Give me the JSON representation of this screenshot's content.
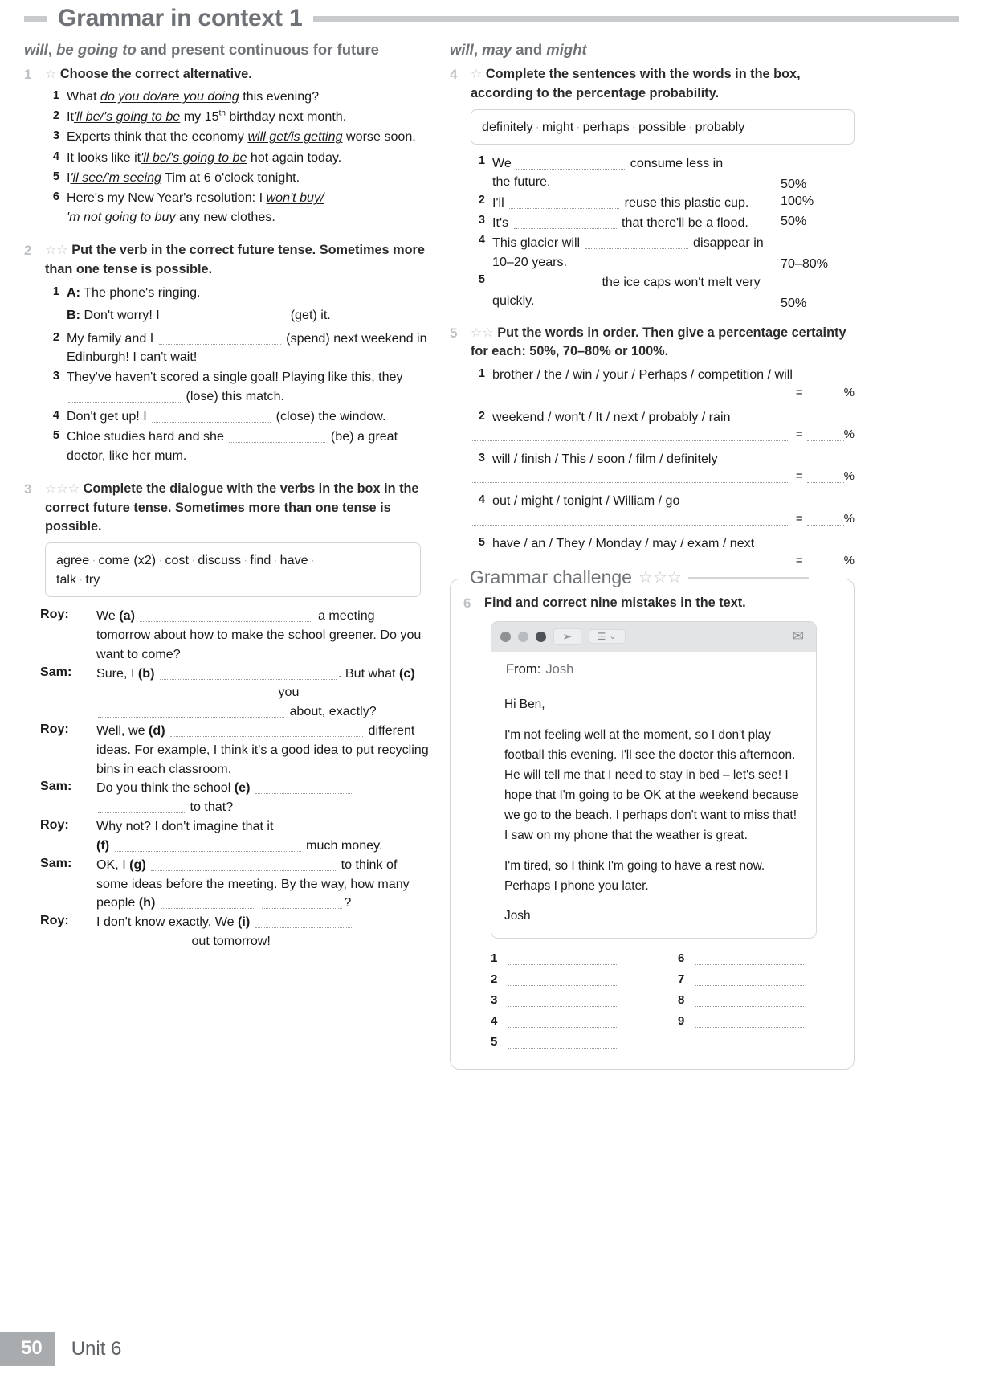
{
  "header": {
    "title": "Grammar in context 1"
  },
  "left": {
    "section_title_html": "will, be going to and present continuous for future",
    "ex1": {
      "num": "1",
      "stars": "☆",
      "rubric": "Choose the correct alternative.",
      "items": [
        "1|What |do you do/are you doing| this evening?",
        "2|It|'ll be/'s going to be| my 15th birthday next month.",
        "3|Experts think that the economy |will get/is getting| worse soon.",
        "4|It looks like it|'ll be/'s going to be| hot again today.",
        "5|I|'ll see/'m seeing| Tim at 6 o'clock tonight.",
        "6|Here's my New Year's resolution: I |won't buy/'m not going to buy| any new clothes."
      ]
    },
    "ex2": {
      "num": "2",
      "stars": "☆☆",
      "rubric": "Put the verb in the correct future tense. Sometimes more than one tense is possible.",
      "items": [
        {
          "n": "1",
          "a": "A: The phone's ringing.",
          "b_pre": "B: Don't worry! I",
          "b_post": "(get) it."
        },
        {
          "n": "2",
          "pre": "My family and I",
          "post": "(spend) next weekend in Edinburgh! I can't wait!"
        },
        {
          "n": "3",
          "lead": "They've haven't scored a single goal! Playing like this, they",
          "post": "(lose) this match."
        },
        {
          "n": "4",
          "pre": "Don't get up! I",
          "post": "(close) the window."
        },
        {
          "n": "5",
          "pre": "Chloe studies hard and she",
          "post": "(be) a great doctor, like her mum."
        }
      ]
    },
    "ex3": {
      "num": "3",
      "stars": "☆☆☆",
      "rubric": "Complete the dialogue with the verbs in the box in the correct future tense. Sometimes more than one tense is possible.",
      "wordbox": [
        "agree",
        "come (x2)",
        "cost",
        "discuss",
        "find",
        "have",
        "talk",
        "try"
      ],
      "dialogue": [
        {
          "speaker": "Roy:",
          "pre": "We ",
          "tag": "(a)",
          "post": " a meeting tomorrow about how to make the school greener. Do you want to come?"
        },
        {
          "speaker": "Sam:",
          "pre": "Sure, I ",
          "tag": "(b)",
          "post": ". But what ",
          "tag2": "(c)",
          "post2": " you ",
          "post3": " about, exactly?"
        },
        {
          "speaker": "Roy:",
          "pre": "Well, we ",
          "tag": "(d)",
          "post": " different ideas. For example, I think it's a good idea to put recycling bins in each classroom."
        },
        {
          "speaker": "Sam:",
          "pre": "Do you think the school ",
          "tag": "(e)",
          "post": " to that?"
        },
        {
          "speaker": "Roy:",
          "pre": "Why not? I don't imagine that it",
          "tag": "(f)",
          "post": " much money."
        },
        {
          "speaker": "Sam:",
          "pre": "OK, I ",
          "tag": "(g)",
          "post": " to think of some ideas before the meeting. By the way, how many people ",
          "tag2": "(h)",
          "post2": "?"
        },
        {
          "speaker": "Roy:",
          "pre": "I don't know exactly. We ",
          "tag": "(i)",
          "post": " out tomorrow!"
        }
      ]
    }
  },
  "right": {
    "section_title_html": "will, may and might",
    "ex4": {
      "num": "4",
      "stars": "☆",
      "rubric": "Complete the sentences with the words in the box, according to the percentage probability.",
      "wordbox": [
        "definitely",
        "might",
        "perhaps",
        "possible",
        "probably"
      ],
      "items": [
        {
          "n": "1",
          "pre": "We",
          "post": "consume less in the future.",
          "pct": "50%"
        },
        {
          "n": "2",
          "pre": "I'll",
          "post": "reuse this plastic cup.",
          "pct": "100%"
        },
        {
          "n": "3",
          "pre": "It's",
          "post": "that there'll be a flood.",
          "pct": "50%"
        },
        {
          "n": "4",
          "pre": "This glacier will",
          "post": "disappear in 10–20 years.",
          "pct": "70–80%"
        },
        {
          "n": "5",
          "pre": "",
          "post": "the ice caps won't melt very quickly.",
          "pct": "50%"
        }
      ]
    },
    "ex5": {
      "num": "5",
      "stars": "☆☆",
      "rubric": "Put the words in order. Then give a percentage certainty for each: 50%, 70–80% or 100%.",
      "eq": "=",
      "pct_sign": "%",
      "items": [
        {
          "n": "1",
          "text": "brother / the / win / your / Perhaps / competition / will"
        },
        {
          "n": "2",
          "text": "weekend / won't / It / next / probably / rain"
        },
        {
          "n": "3",
          "text": "will / finish / This / soon / film / definitely"
        },
        {
          "n": "4",
          "text": "out / might / tonight / William / go"
        },
        {
          "n": "5",
          "text": "have / an / They / Monday / may / exam / next"
        }
      ]
    },
    "challenge": {
      "title": "Grammar challenge",
      "stars": "☆☆☆",
      "ex6": {
        "num": "6",
        "rubric": "Find and correct nine mistakes in the text."
      },
      "email": {
        "dots": [
          "#8e9194",
          "#b9bcbf",
          "#4f5255"
        ],
        "send_icon": "➢",
        "menu_icon": "☰",
        "chevron_icon": "⌄",
        "envelope_icon": "✉",
        "from_label": "From:",
        "from_value": "Josh",
        "paragraphs": [
          "Hi Ben,",
          "I'm not feeling well at the moment, so I don't play football this evening. I'll see the doctor this afternoon. He will tell me that I need to stay in bed – let's see! I hope that I'm going to be OK at the weekend because we go to the beach. I perhaps don't want to miss that! I saw on my phone that the weather is great.",
          "I'm tired, so I think I'm going to have a rest now. Perhaps I phone you later.",
          "Josh"
        ]
      },
      "answers_left": [
        "1",
        "2",
        "3",
        "4",
        "5"
      ],
      "answers_right": [
        "6",
        "7",
        "8",
        "9"
      ]
    }
  },
  "footer": {
    "page": "50",
    "unit": "Unit 6"
  }
}
